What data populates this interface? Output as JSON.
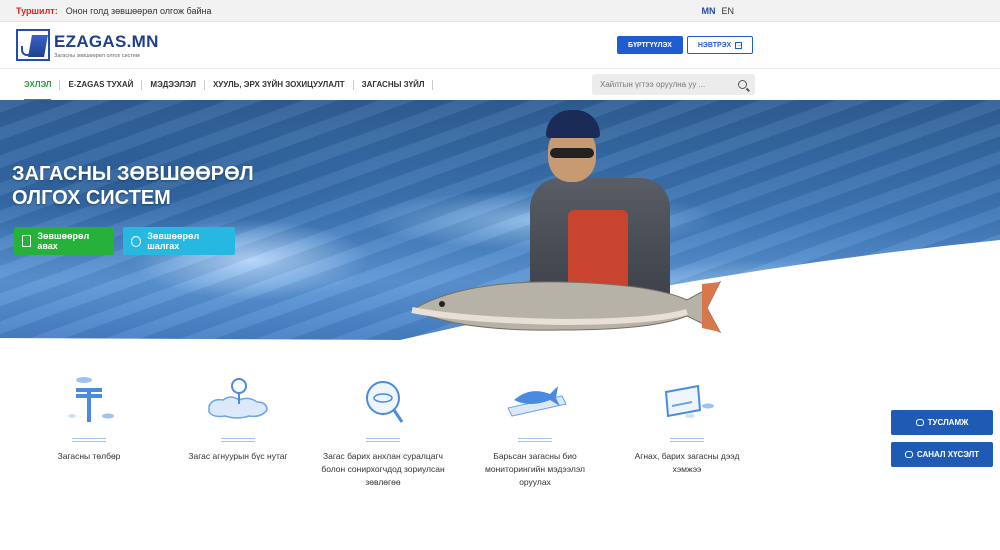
{
  "topbar": {
    "notice_label": "Туршилт:",
    "notice_text": "Онон голд зөвшөөрөл олгож байна",
    "lang_mn": "MN",
    "lang_en": "EN"
  },
  "header": {
    "logo_title": "EZAGAS.MN",
    "logo_subtitle": "Загасны зөвшөөрөл олгох систем",
    "register_label": "БҮРТГҮҮЛЭХ",
    "login_label": "НЭВТРЭХ"
  },
  "nav": {
    "items": [
      {
        "label": "ЭХЛЭЛ",
        "active": true
      },
      {
        "label": "E-ZAGAS ТУХАЙ",
        "active": false
      },
      {
        "label": "МЭДЭЭЛЭЛ",
        "active": false
      },
      {
        "label": "ХУУЛЬ, ЭРХ ЗҮЙН ЗОХИЦУУЛАЛТ",
        "active": false
      },
      {
        "label": "ЗАГАСНЫ ЗҮЙЛ",
        "active": false
      }
    ],
    "search_placeholder": "Хайлтын үгтээ оруулна уу ..."
  },
  "hero": {
    "title_line1": "ЗАГАСНЫ ЗӨВШӨӨРӨЛ",
    "title_line2": "ОЛГОХ СИСТЕМ",
    "btn_get_label": "Зөвшөөрөл авах",
    "btn_check_label": "Зөвшөөрөл шалгах"
  },
  "services": [
    {
      "label": "Загасны төлбөр",
      "icon": "tugrik-fish-icon"
    },
    {
      "label": "Загас агнуурын бүс нутаг",
      "icon": "map-pin-icon"
    },
    {
      "label": "Загас барих анхлан суралцагч болон сонирхогчдод зориулсан зөвлөгөө",
      "icon": "magnifier-fish-icon"
    },
    {
      "label": "Барьсан загасны био мониторингийн мэдээлэл оруулах",
      "icon": "fish-ruler-icon"
    },
    {
      "label": "Агнах, барих загасны дээд хэмжээ",
      "icon": "board-fish-icon"
    }
  ],
  "floating": {
    "help_label": "ТУСЛАМЖ",
    "feedback_label": "САНАЛ ХҮСЭЛТ"
  }
}
